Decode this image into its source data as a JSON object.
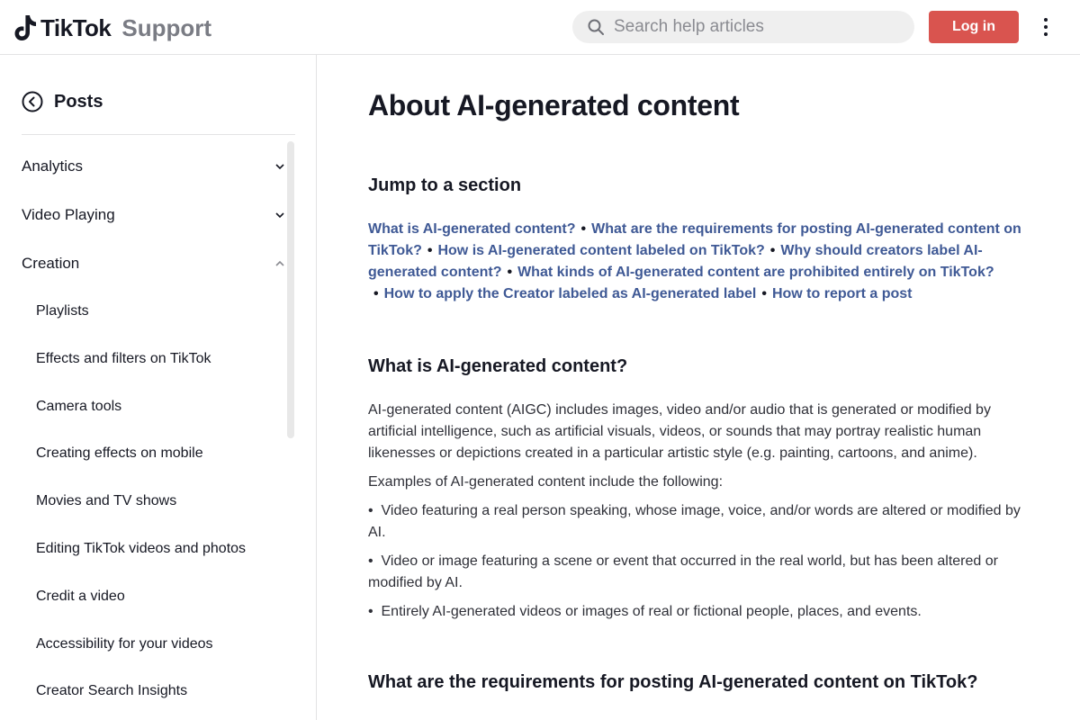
{
  "header": {
    "logo_text": "TikTok",
    "logo_sub": "Support",
    "search_placeholder": "Search help articles",
    "login_label": "Log in"
  },
  "sidebar": {
    "back_label": "Posts",
    "sections": [
      {
        "label": "Analytics",
        "state": "collapsed"
      },
      {
        "label": "Video Playing",
        "state": "collapsed"
      },
      {
        "label": "Creation",
        "state": "expanded"
      }
    ],
    "creation_items": [
      "Playlists",
      "Effects and filters on TikTok",
      "Camera tools",
      "Creating effects on mobile",
      "Movies and TV shows",
      "Editing TikTok videos and photos",
      "Credit a video",
      "Accessibility for your videos",
      "Creator Search Insights"
    ]
  },
  "article": {
    "title": "About AI-generated content",
    "jump_heading": "Jump to a section",
    "jump_links": [
      "What is AI-generated content?",
      "What are the requirements for posting AI-generated content on TikTok?",
      "How is AI-generated content labeled on TikTok?",
      "Why should creators label AI-generated content?",
      "What kinds of AI-generated content are prohibited entirely on TikTok?",
      "How to apply the Creator labeled as AI-generated label",
      "How to report a post"
    ],
    "section1_heading": "What is AI-generated content?",
    "section1_para": "AI-generated content (AIGC) includes images, video and/or audio that is generated or modified by artificial intelligence, such as artificial visuals, videos, or sounds that may portray realistic human likenesses or depictions created in a particular artistic style (e.g. painting, cartoons, and anime).",
    "examples_intro": "Examples of AI-generated content include the following:",
    "examples": [
      "Video featuring a real person speaking, whose image, voice, and/or words are altered or modified by AI.",
      "Video or image featuring a scene or event that occurred in the real world, but has been altered or modified by AI.",
      "Entirely AI-generated videos or images of real or fictional people, places, and events."
    ],
    "section2_heading": "What are the requirements for posting AI-generated content on TikTok?"
  },
  "colors": {
    "brand_red": "#d9544f",
    "link_blue": "#3f5995",
    "text": "#161823"
  }
}
